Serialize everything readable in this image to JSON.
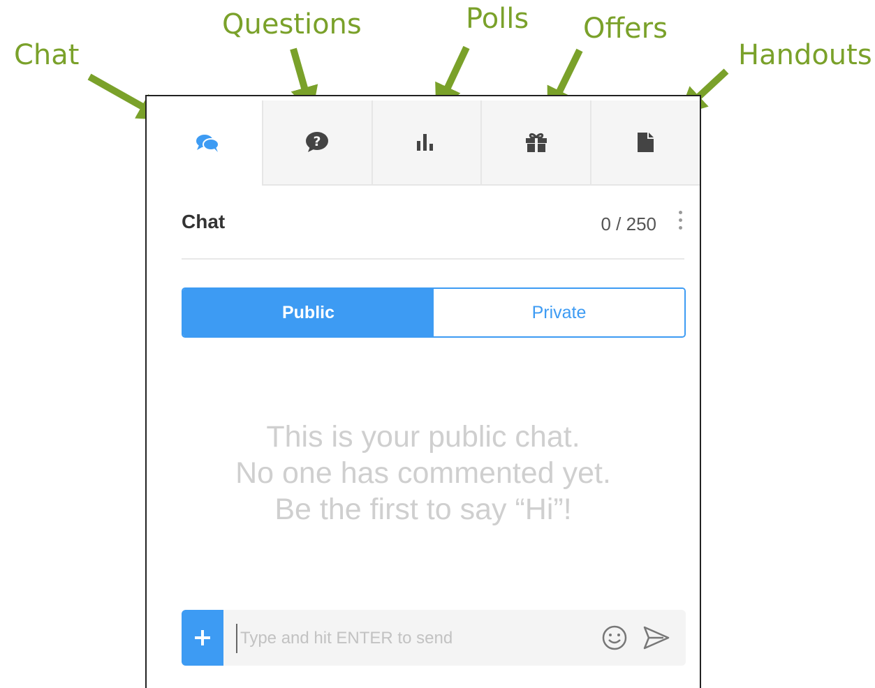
{
  "annotations": {
    "chat": "Chat",
    "questions": "Questions",
    "polls": "Polls",
    "offers": "Offers",
    "handouts": "Handouts"
  },
  "tabs": [
    {
      "icon": "chat-bubbles-icon",
      "active": true
    },
    {
      "icon": "question-bubble-icon",
      "active": false
    },
    {
      "icon": "bar-chart-icon",
      "active": false
    },
    {
      "icon": "gift-icon",
      "active": false
    },
    {
      "icon": "document-icon",
      "active": false
    }
  ],
  "chat": {
    "title": "Chat",
    "count": "0 / 250"
  },
  "toggle": {
    "public_label": "Public",
    "private_label": "Private",
    "selected": "Public"
  },
  "empty_state": {
    "line1": "This is your public chat.",
    "line2": "No one has commented yet.",
    "line3": "Be the first to say “Hi”!"
  },
  "composer": {
    "placeholder": "Type and hit ENTER to send",
    "value": ""
  },
  "colors": {
    "accent": "#3d9bf3",
    "annotation": "#7aa12a"
  }
}
